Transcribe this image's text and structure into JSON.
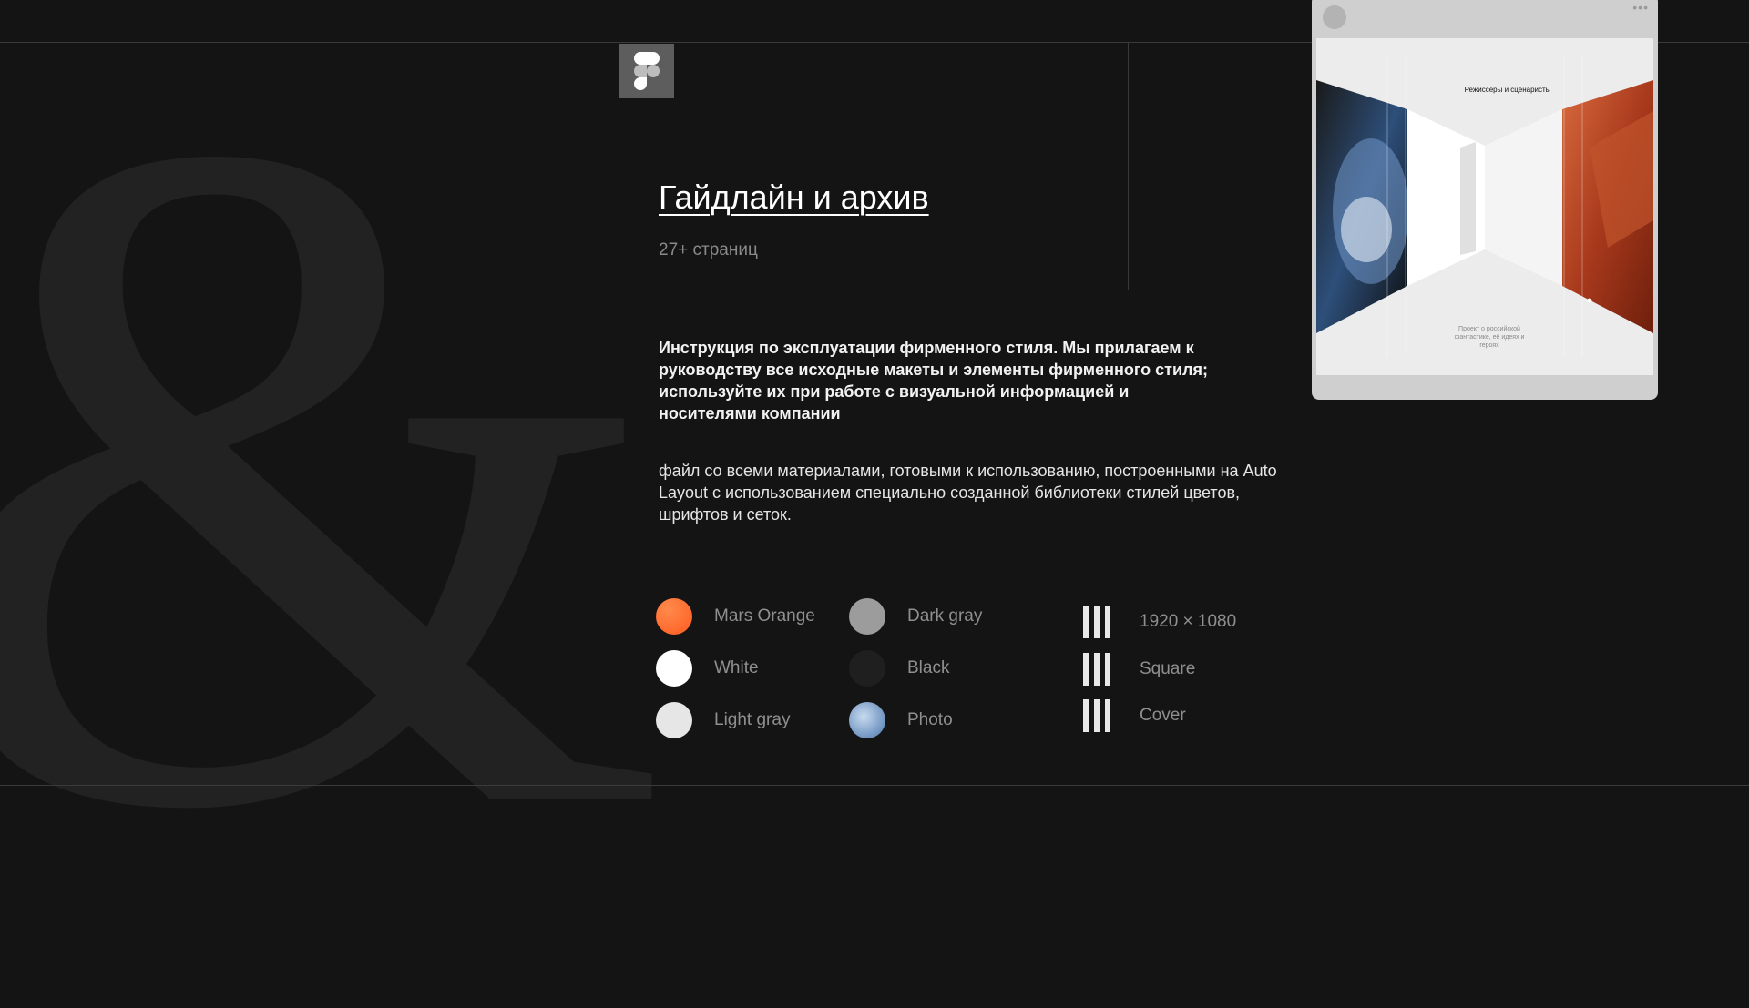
{
  "hero": {
    "title": "Гайдлайн и архив",
    "pages": "27+ страниц",
    "description_bold": "Инструкция по эксплуатации фирменного стиля. Мы прилагаем к руководству все исходные макеты и элементы фирменного стиля; используйте их при работе с визуальной информацией и носителями компании",
    "description": "файл со всеми материалами, готовыми к использованию, построенными на Auto Layout с использованием специально созданной библиотеки стилей цветов, шрифтов и сеток."
  },
  "background_glyph": "&",
  "palette": [
    {
      "label": "Mars Orange",
      "color": "#ff6a2b"
    },
    {
      "label": "Dark gray",
      "color": "#9c9c9c"
    },
    {
      "label": "White",
      "color": "#ffffff"
    },
    {
      "label": "Black",
      "color": "#1f1f1f"
    },
    {
      "label": "Light gray",
      "color": "#e6e6e6"
    },
    {
      "label": "Photo",
      "color": "#8fb0d8"
    }
  ],
  "formats": [
    {
      "label": "1920 × 1080",
      "icon": "grid-bars-icon"
    },
    {
      "label": "Square",
      "icon": "grid-bars-icon"
    },
    {
      "label": "Cover",
      "icon": "grid-bars-icon"
    }
  ],
  "preview": {
    "menu": "•••",
    "poster_title": "Режиссёры и сценаристы",
    "poster_caption": "Проект о российской фантастике, её идеях и героях"
  },
  "icons": {
    "figma_logo": "figma-logo-icon",
    "window_dot": "avatar-circle",
    "window_menu": "more-icon"
  }
}
